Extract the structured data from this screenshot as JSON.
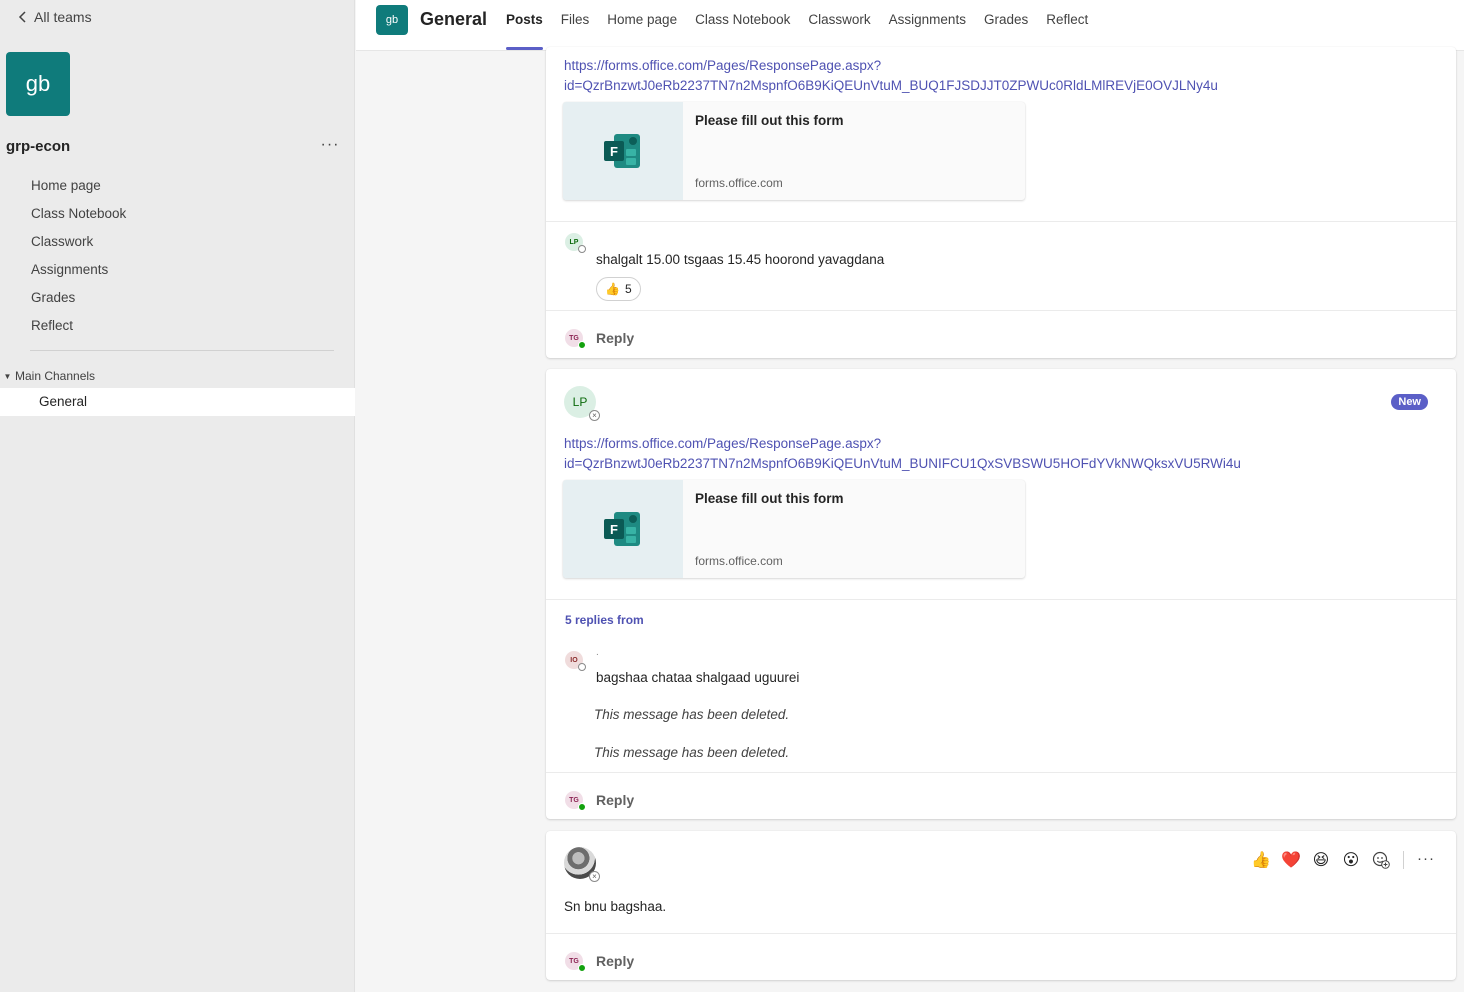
{
  "sidebar": {
    "back_label": "All teams",
    "team_initials": "gb",
    "team_name": "grp-econ",
    "more_label": "···",
    "nav": [
      "Home page",
      "Class Notebook",
      "Classwork",
      "Assignments",
      "Grades",
      "Reflect"
    ],
    "channels_header": "Main Channels",
    "active_channel": "General"
  },
  "header": {
    "tile_initials": "gb",
    "title": "General",
    "tabs": [
      "Posts",
      "Files",
      "Home page",
      "Class Notebook",
      "Classwork",
      "Assignments",
      "Grades",
      "Reflect"
    ],
    "active_tab": "Posts"
  },
  "posts": [
    {
      "link_line1": "https://forms.office.com/Pages/ResponsePage.aspx?",
      "link_line2": "id=QzrBnzwtJ0eRb2237TN7n2MspnfO6B9KiQEUnVtuM_BUQ1FJSDJJT0ZPWUc0RldLMlREVjE0OVJLNy4u",
      "preview_title": "Please fill out this form",
      "preview_domain": "forms.office.com",
      "reply": {
        "initials": "LP",
        "text": "shalgalt 15.00 tsgaas 15.45 hoorond yavagdana",
        "reaction_count": "5"
      },
      "reply_initials": "TG",
      "reply_label": "Reply"
    },
    {
      "author_initials": "LP",
      "badge": "New",
      "link_line1": "https://forms.office.com/Pages/ResponsePage.aspx?",
      "link_line2": "id=QzrBnzwtJ0eRb2237TN7n2MspnfO6B9KiQEUnVtuM_BUNIFCU1QxSVBSWU5HOFdYVkNWQksxVU5RWi4u",
      "preview_title": "Please fill out this form",
      "preview_domain": "forms.office.com",
      "replies_from": "5 replies from",
      "reply_author_initials": "IO",
      "reply_dot": ".",
      "reply_text": "bagshaa chataa shalgaad uguurei",
      "deleted_1": "This message has been deleted.",
      "deleted_2": "This message has been deleted.",
      "reply_initials": "TG",
      "reply_label": "Reply"
    },
    {
      "text": "Sn bnu bagshaa.",
      "reactions": [
        "👍",
        "❤️",
        "😆",
        "😮"
      ],
      "reply_initials": "TG",
      "reply_label": "Reply"
    }
  ],
  "icons": {
    "back": "chevron-left-icon",
    "forms": "microsoft-forms-icon",
    "add_reaction": "add-reaction-icon",
    "more": "more-options-icon"
  },
  "colors": {
    "accent": "#5b5fc7",
    "link": "#4f52b2",
    "team_tile": "#0f7b7b",
    "presence_available": "#13a10e"
  }
}
